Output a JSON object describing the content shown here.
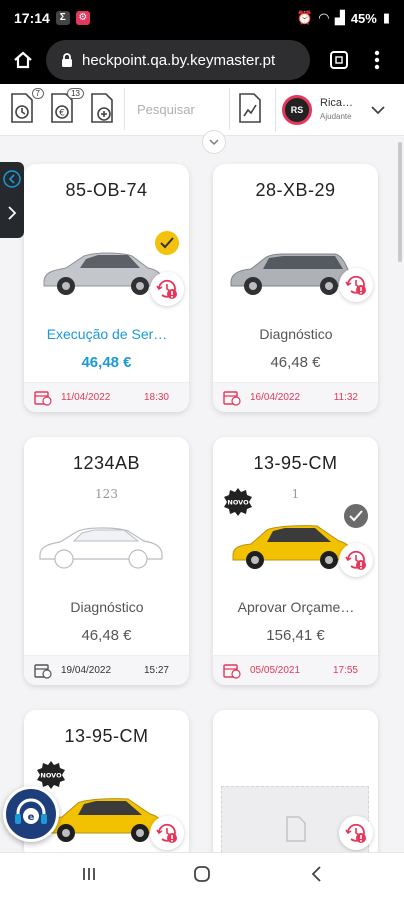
{
  "status_bar": {
    "time": "17:14",
    "battery": "45%"
  },
  "browser": {
    "url": "heckpoint.qa.by.keymaster.pt"
  },
  "toolbar": {
    "badge_1": "7",
    "badge_2": "13",
    "search_placeholder": "Pesquisar",
    "user_initials": "RS",
    "user_name": "Rica…",
    "user_role": "Ajudante"
  },
  "cards": [
    {
      "plate": "85-OB-74",
      "subtitle": "",
      "status": "Execução de Ser…",
      "price": "46,48 €",
      "date": "11/04/2022",
      "time": "18:30",
      "car_color": "#b9bcc0",
      "checked": "yellow"
    },
    {
      "plate": "28-XB-29",
      "subtitle": "",
      "status": "Diagnóstico",
      "price": "46,48 €",
      "date": "16/04/2022",
      "time": "11:32",
      "car_color": "#a8abb0"
    },
    {
      "plate": "1234AB",
      "subtitle": "123",
      "status": "Diagnóstico",
      "price": "46,48 €",
      "date": "19/04/2022",
      "time": "15:27",
      "car_color": "#ffffff"
    },
    {
      "plate": "13-95-CM",
      "subtitle": "1",
      "status": "Aprovar Orçame…",
      "price": "156,41 €",
      "date": "05/05/2021",
      "time": "17:55",
      "car_color": "#f2c200",
      "checked": "grey",
      "badge": "NOVO"
    },
    {
      "plate": "13-95-CM",
      "subtitle": "",
      "car_color": "#f2c200",
      "badge": "NOVO"
    },
    {
      "plate": "",
      "subtitle": ""
    }
  ],
  "colors": {
    "accent": "#1a9ad6",
    "alert": "#e5375b",
    "check_yellow": "#f4c20d",
    "check_grey": "#6b6b6b"
  }
}
